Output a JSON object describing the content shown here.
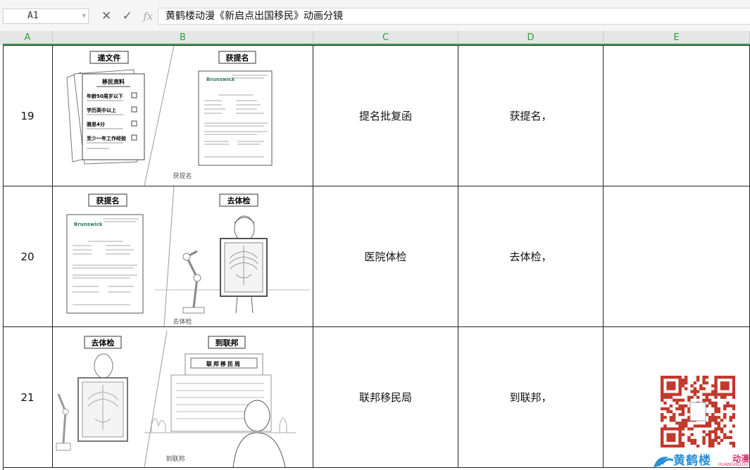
{
  "formula_bar": {
    "cell_ref": "A1",
    "cancel_icon": "✕",
    "confirm_icon": "✓",
    "fx_label": "fx",
    "content": "黄鹤楼动漫《新启点出国移民》动画分镜"
  },
  "columns": [
    "A",
    "B",
    "C",
    "D",
    "E"
  ],
  "rows": [
    {
      "num": "19",
      "c": "提名批复函",
      "d": "获提名，",
      "sketch": {
        "left_label": "递文件",
        "right_label": "获提名",
        "caption": "获提名",
        "form_title": "移民资料",
        "form_items": [
          "年龄50周岁以下",
          "学历高中以上",
          "雅思4分",
          "至少一年工作经验"
        ]
      }
    },
    {
      "num": "20",
      "c": "医院体检",
      "d": "去体检，",
      "sketch": {
        "left_label": "获提名",
        "right_label": "去体检",
        "caption": "去体检"
      }
    },
    {
      "num": "21",
      "c": "联邦移民局",
      "d": "到联邦，",
      "sketch": {
        "left_label": "去体检",
        "right_label": "到联邦",
        "caption": "到联邦",
        "building_sign": "联邦移民局"
      }
    }
  ],
  "watermark": {
    "brand": "黄鹤楼",
    "anim": "动漫",
    "sub": "HUANGHELOU"
  }
}
